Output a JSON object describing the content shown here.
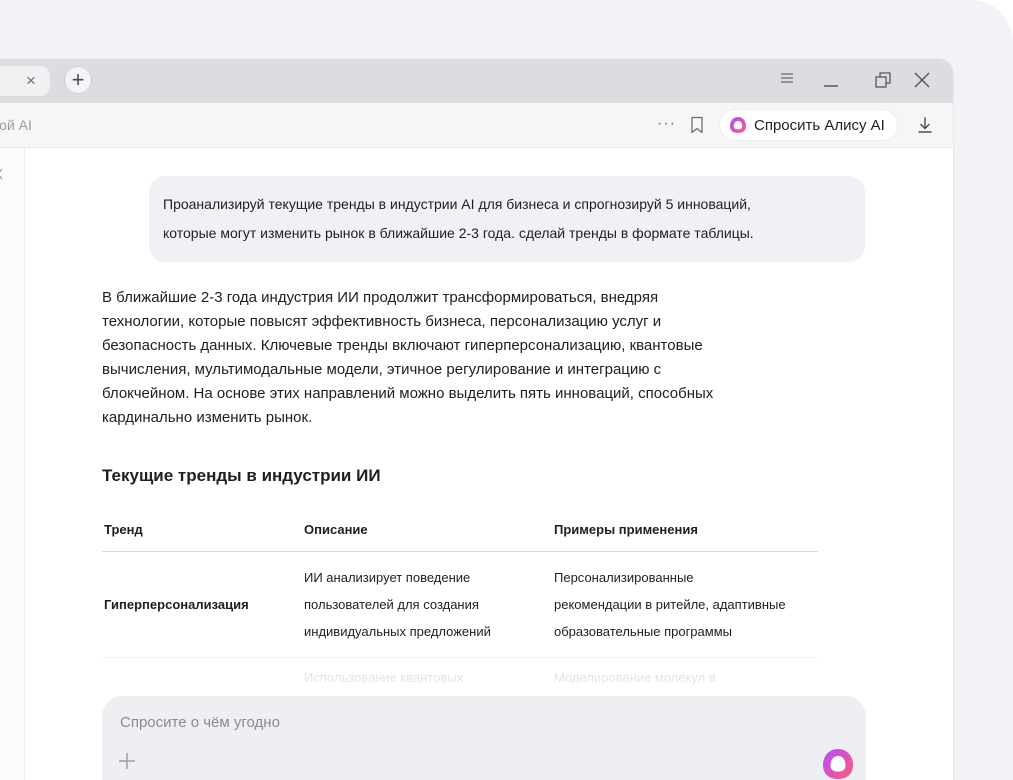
{
  "browser": {
    "tab_close_glyph": "×",
    "new_tab_glyph": "+",
    "address_text": "сой AI",
    "more_glyph": "···",
    "ask_alice_label": "Спросить Алису AI"
  },
  "chat": {
    "user_message_line1": "Проанализируй текущие тренды в индустрии AI для бизнеса и спрогнозируй 5 инноваций,",
    "user_message_line2": "которые могут изменить рынок в ближайшие 2-3 года. сделай тренды в формате таблицы.",
    "answer_lines": [
      "В ближайшие 2-3 года индустрия ИИ продолжит трансформироваться, внедряя",
      "технологии, которые повысят эффективность бизнеса, персонализацию услуг и",
      "безопасность данных. Ключевые тренды включают гиперперсонализацию, квантовые",
      "вычисления, мультимодальные модели, этичное регулирование и интеграцию с",
      "блокчейном. На основе этих направлений можно выделить пять инноваций, способных",
      "кардинально изменить рынок."
    ],
    "section_title": "Текущие тренды в индустрии ИИ",
    "table": {
      "headers": [
        "Тренд",
        "Описание",
        "Примеры применения"
      ],
      "rows": [
        {
          "trend": "Гиперперсонализация",
          "description_lines": [
            "ИИ анализирует поведение",
            "пользователей для создания",
            "индивидуальных предложений"
          ],
          "examples_lines": [
            "Персонализированные",
            "рекомендации в ритейле, адаптивные",
            "образовательные программы"
          ]
        },
        {
          "trend": "",
          "description_lines": [
            "Использование квантовых"
          ],
          "examples_lines": [
            "Моделирование молекул в"
          ]
        }
      ]
    }
  },
  "composer": {
    "placeholder": "Спросите о чём угодно"
  },
  "colors": {
    "alice_gradient_start": "#b44cff",
    "alice_gradient_end": "#ff5a7a"
  }
}
